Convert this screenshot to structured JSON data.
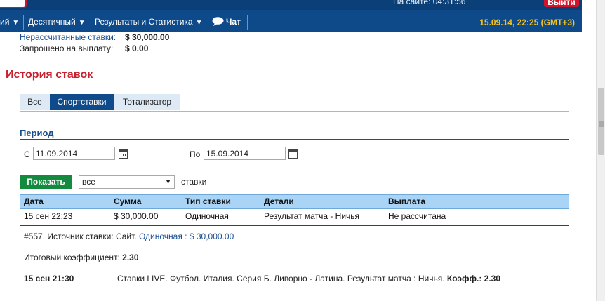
{
  "header": {
    "online_label": "На сайте: 04:31:56",
    "logout_label": "Выйти",
    "menu": [
      {
        "label": "ий"
      },
      {
        "label": "Десятичный"
      },
      {
        "label": "Результаты и Статистика"
      },
      {
        "label": "Чат"
      }
    ],
    "datetime": "15.09.14, 22:25 (GMT+3)"
  },
  "balance": {
    "unsettled_label": "Нерассчитанные ставки:",
    "unsettled_value": "$ 30,000.00",
    "requested_label": "Запрошено на выплату:",
    "requested_value": "$ 0.00"
  },
  "history": {
    "title": "История ставок",
    "tabs": [
      {
        "label": "Все"
      },
      {
        "label": "Спортставки"
      },
      {
        "label": "Тотализатор"
      }
    ],
    "active_tab": "Спортставки",
    "period_label": "Период",
    "from_label": "С",
    "from_value": "11.09.2014",
    "to_label": "По",
    "to_value": "15.09.2014",
    "show_button": "Показать",
    "filter_value": "все",
    "filter_suffix": "ставки"
  },
  "table": {
    "columns": [
      "Дата",
      "Сумма",
      "Тип ставки",
      "Детали",
      "Выплата"
    ],
    "rows": [
      [
        "15 сен 22:23",
        "$ 30,000.00",
        "Одиночная",
        "Результат матча - Ничья",
        "Не рассчитана"
      ]
    ]
  },
  "details": {
    "source_prefix": "#557. Источник ставки: Сайт.",
    "source_link": "Одиночная : $ 30,000.00",
    "coef_label": "Итоговый коэффициент:",
    "coef_value": "2.30",
    "event_time": "15 сен 21:30",
    "event_text": "Ставки LIVE. Футбол. Италия. Серия Б. Ливорно - Латина. Результат матча : Ничья.",
    "event_coef_label": "Коэфф.:",
    "event_coef_value": "2.30"
  },
  "colors": {
    "nav_bg": "#0e4a8a",
    "accent_red": "#c8202e",
    "datetime": "#f7c21c",
    "show_button": "#138a3e",
    "table_header": "#a9d4f5"
  }
}
